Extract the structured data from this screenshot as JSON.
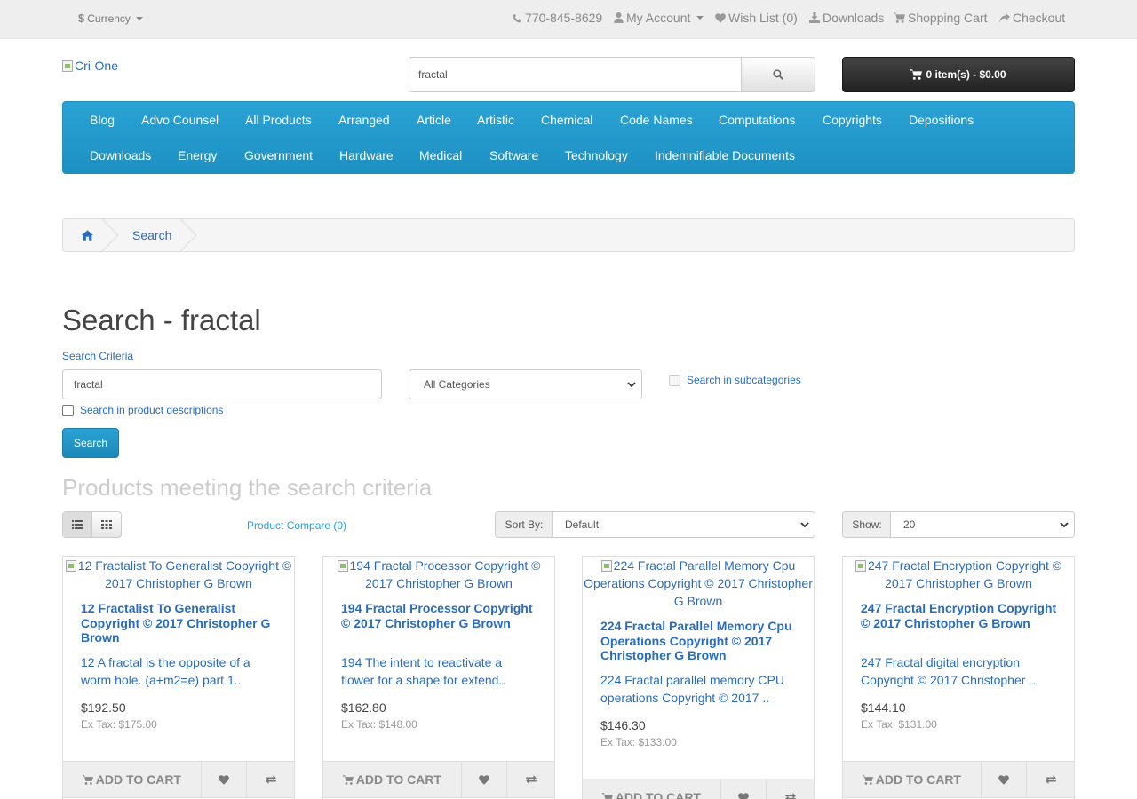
{
  "topbar": {
    "currency_label": "Currency",
    "phone": "770-845-8629",
    "my_account": "My Account",
    "wish_list": "Wish List (0)",
    "downloads": "Downloads",
    "shopping_cart": "Shopping Cart",
    "checkout": "Checkout"
  },
  "header": {
    "logo_alt": "Cri-One",
    "search_value": "fractal",
    "cart_summary": "0 item(s) - $0.00"
  },
  "menu": {
    "row1": [
      "Blog",
      "Advo Counsel",
      "All Products",
      "Arranged",
      "Article",
      "Artistic",
      "Chemical",
      "Code Names",
      "Computations",
      "Copyrights",
      "Depositions"
    ],
    "row2": [
      "Downloads",
      "Energy",
      "Government",
      "Hardware",
      "Medical",
      "Software",
      "Technology",
      "Indemnifiable Documents"
    ]
  },
  "breadcrumb": {
    "current": "Search"
  },
  "search": {
    "title": "Search - fractal",
    "criteria_label": "Search Criteria",
    "criteria_value": "fractal",
    "category_selected": "All Categories",
    "subcategories_label": "Search in subcategories",
    "descriptions_label": "Search in product descriptions",
    "button_label": "Search"
  },
  "results": {
    "heading": "Products meeting the search criteria",
    "compare_link": "Product Compare (0)",
    "sort_label": "Sort By:",
    "sort_value": "Default",
    "show_label": "Show:",
    "show_value": "20"
  },
  "products": [
    {
      "image_alt": "12 Fractalist To Generalist Copyright © 2017 Christopher G Brown",
      "name": "12 Fractalist To Generalist Copyright © 2017 Christopher G Brown",
      "description": "12 A fractal is the opposite of a worm hole.  (a+m2=e) part 1..",
      "price": "$192.50",
      "ex_tax": "Ex Tax: $175.00",
      "add_to_cart": "ADD TO CART"
    },
    {
      "image_alt": "194 Fractal Processor Copyright © 2017 Christopher G Brown",
      "name": "194 Fractal Processor Copyright © 2017 Christopher G Brown",
      "description": "194 The intent to reactivate a flower for a shape for extend..",
      "price": "$162.80",
      "ex_tax": "Ex Tax: $148.00",
      "add_to_cart": "ADD TO CART"
    },
    {
      "image_alt": "224 Fractal Parallel Memory Cpu Operations Copyright © 2017 Christopher G Brown",
      "name": "224 Fractal Parallel Memory Cpu Operations Copyright © 2017 Christopher G Brown",
      "description": "224 Fractal parallel memory CPU operations Copyright © 2017 ..",
      "price": "$146.30",
      "ex_tax": "Ex Tax: $133.00",
      "add_to_cart": "ADD TO CART"
    },
    {
      "image_alt": "247 Fractal Encryption Copyright © 2017 Christopher G Brown",
      "name": "247 Fractal Encryption Copyright © 2017 Christopher G Brown",
      "description": "247 Fractal digital encryption Copyright © 2017 Christopher ..",
      "price": "$144.10",
      "ex_tax": "Ex Tax: $131.00",
      "add_to_cart": "ADD TO CART"
    }
  ],
  "icons": {
    "currency": "dollar-icon",
    "phone": "phone-icon",
    "account": "user-icon",
    "wishlist": "heart-icon",
    "downloads": "download-icon",
    "cart": "cart-icon",
    "checkout": "share-icon",
    "search": "search-icon",
    "home": "home-icon",
    "list_view": "list-icon",
    "grid_view": "grid-icon",
    "compare": "exchange-icon"
  },
  "colors": {
    "accent": "#229ac8",
    "link": "#2a6cbc",
    "cart_button": "#303030"
  }
}
